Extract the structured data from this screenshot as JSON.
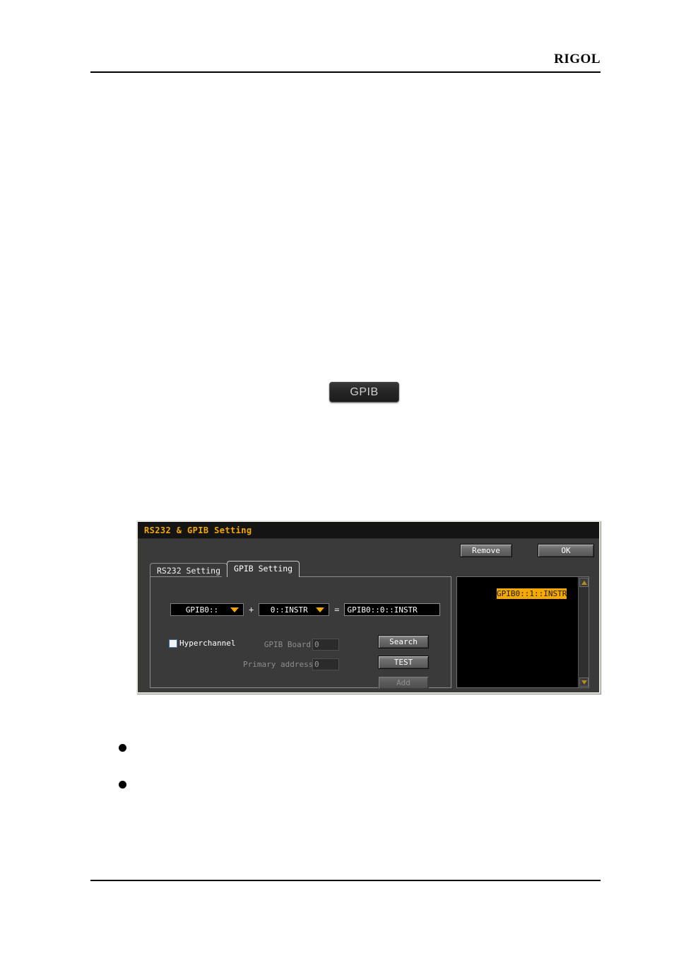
{
  "page": {
    "brand": "RIGOL"
  },
  "softkey": {
    "label": "GPIB"
  },
  "bullets": [
    {
      "text": ""
    },
    {
      "text": ""
    }
  ],
  "dialog": {
    "title": "RS232 & GPIB Setting",
    "top_actions": {
      "remove_label": "Remove",
      "ok_label": "OK"
    },
    "tabs": [
      {
        "label": "RS232 Setting",
        "active": false
      },
      {
        "label": "GPIB Setting",
        "active": true
      }
    ],
    "address_composer": {
      "prefix_value": "GPIB0::",
      "operator": "+",
      "suffix_value": "0::INSTR",
      "equals": "=",
      "result_value": "GPIB0::0::INSTR"
    },
    "options": {
      "hyperchannel_label": "Hyperchannel",
      "hyperchannel_checked": false,
      "gpib_board_label": "GPIB Board",
      "gpib_board_value": "0",
      "primary_address_label": "Primary address",
      "primary_address_value": "0"
    },
    "side_buttons": {
      "search_label": "Search",
      "test_label": "TEST",
      "add_label": "Add",
      "add_disabled": true
    },
    "instrument_list": {
      "items": [
        {
          "text": "GPIB0::1::INSTR",
          "selected": true
        }
      ]
    },
    "colors": {
      "accent": "#f5a800",
      "dialog_background": "#3a3a3a",
      "titlebar_background": "#141414",
      "list_background": "#000000",
      "border_light": "#e8e6dd"
    }
  }
}
